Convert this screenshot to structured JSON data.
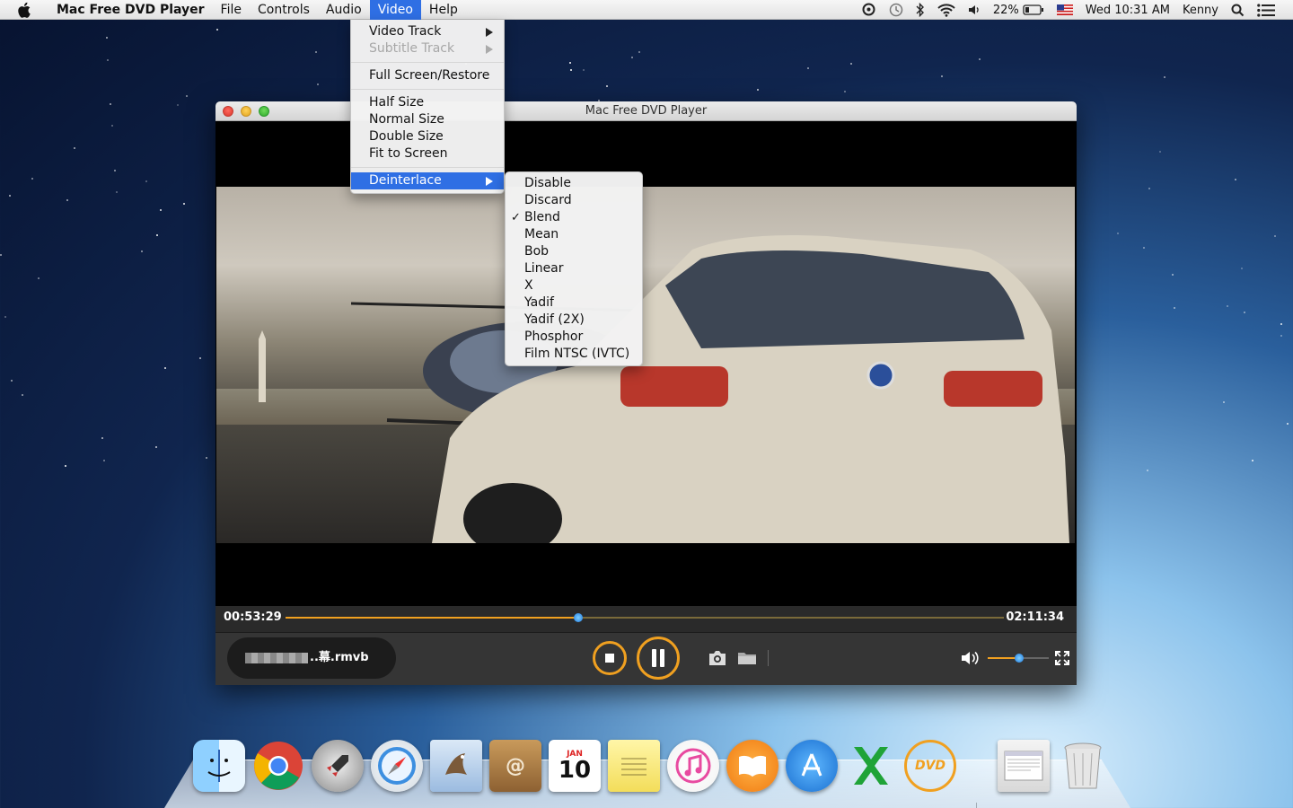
{
  "menubar": {
    "app_name": "Mac Free DVD Player",
    "menus": [
      "File",
      "Controls",
      "Audio",
      "Video",
      "Help"
    ],
    "active_menu": "Video",
    "status": {
      "battery": "22%",
      "clock": "Wed 10:31 AM",
      "user": "Kenny"
    }
  },
  "video_menu": {
    "items": [
      {
        "label": "Video Track",
        "submenu": true,
        "enabled": true
      },
      {
        "label": "Subtitle Track",
        "submenu": true,
        "enabled": false
      },
      {
        "label": "Full Screen/Restore",
        "submenu": false,
        "enabled": true
      },
      {
        "label": "Half Size",
        "submenu": false,
        "enabled": true
      },
      {
        "label": "Normal Size",
        "submenu": false,
        "enabled": true
      },
      {
        "label": "Double Size",
        "submenu": false,
        "enabled": true
      },
      {
        "label": "Fit to Screen",
        "submenu": false,
        "enabled": true
      },
      {
        "label": "Deinterlace",
        "submenu": true,
        "enabled": true,
        "highlighted": true
      }
    ]
  },
  "deinterlace_menu": {
    "items": [
      "Disable",
      "Discard",
      "Blend",
      "Mean",
      "Bob",
      "Linear",
      "X",
      "Yadif",
      "Yadif (2X)",
      "Phosphor",
      "Film NTSC (IVTC)"
    ],
    "checked": "Blend"
  },
  "player": {
    "window_title": "Mac Free DVD Player",
    "current_time": "00:53:29",
    "total_time": "02:11:34",
    "progress_fraction": 0.407,
    "filename": "..幕.rmvb",
    "volume_fraction": 0.52,
    "accent_color": "#f0a020"
  },
  "dock": {
    "apps": [
      "Finder",
      "Google Chrome",
      "Launchpad",
      "Safari",
      "Mail",
      "Contacts",
      "Calendar",
      "Notes",
      "iTunes",
      "iBooks",
      "App Store",
      "Excel",
      "DVD Player",
      "Preview",
      "Trash"
    ],
    "calendar_month": "JAN",
    "calendar_day": "10",
    "dvd_label": "DVD"
  }
}
